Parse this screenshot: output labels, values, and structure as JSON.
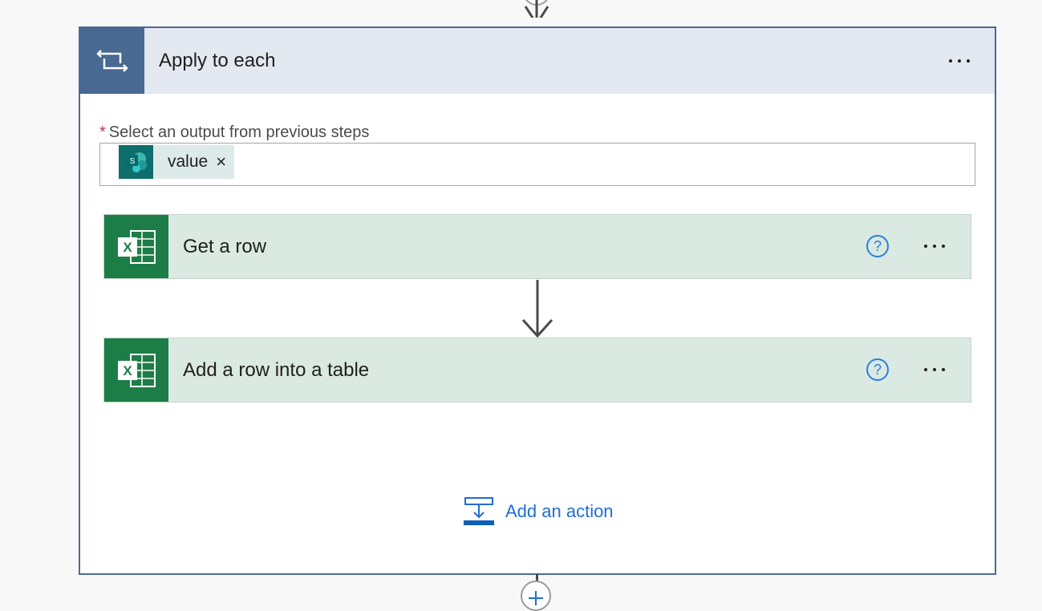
{
  "apply_to_each": {
    "title": "Apply to each",
    "required_mark": "*",
    "select_label": "Select an output from previous steps",
    "token": {
      "label": "value",
      "remove": "×",
      "icon": "sharepoint-icon"
    }
  },
  "actions": [
    {
      "title": "Get a row",
      "help": "?",
      "icon": "excel-icon"
    },
    {
      "title": "Add a row into a table",
      "help": "?",
      "icon": "excel-icon"
    }
  ],
  "add_action": {
    "label": "Add an action"
  },
  "colors": {
    "container_border": "#4b6a95",
    "container_header": "#e4e8f0",
    "loop_icon_bg": "#486991",
    "action_bg": "#dae9e1",
    "excel_green": "#1c7e46",
    "sharepoint_teal": "#0d6e6b",
    "link_blue": "#1f6ed4"
  }
}
